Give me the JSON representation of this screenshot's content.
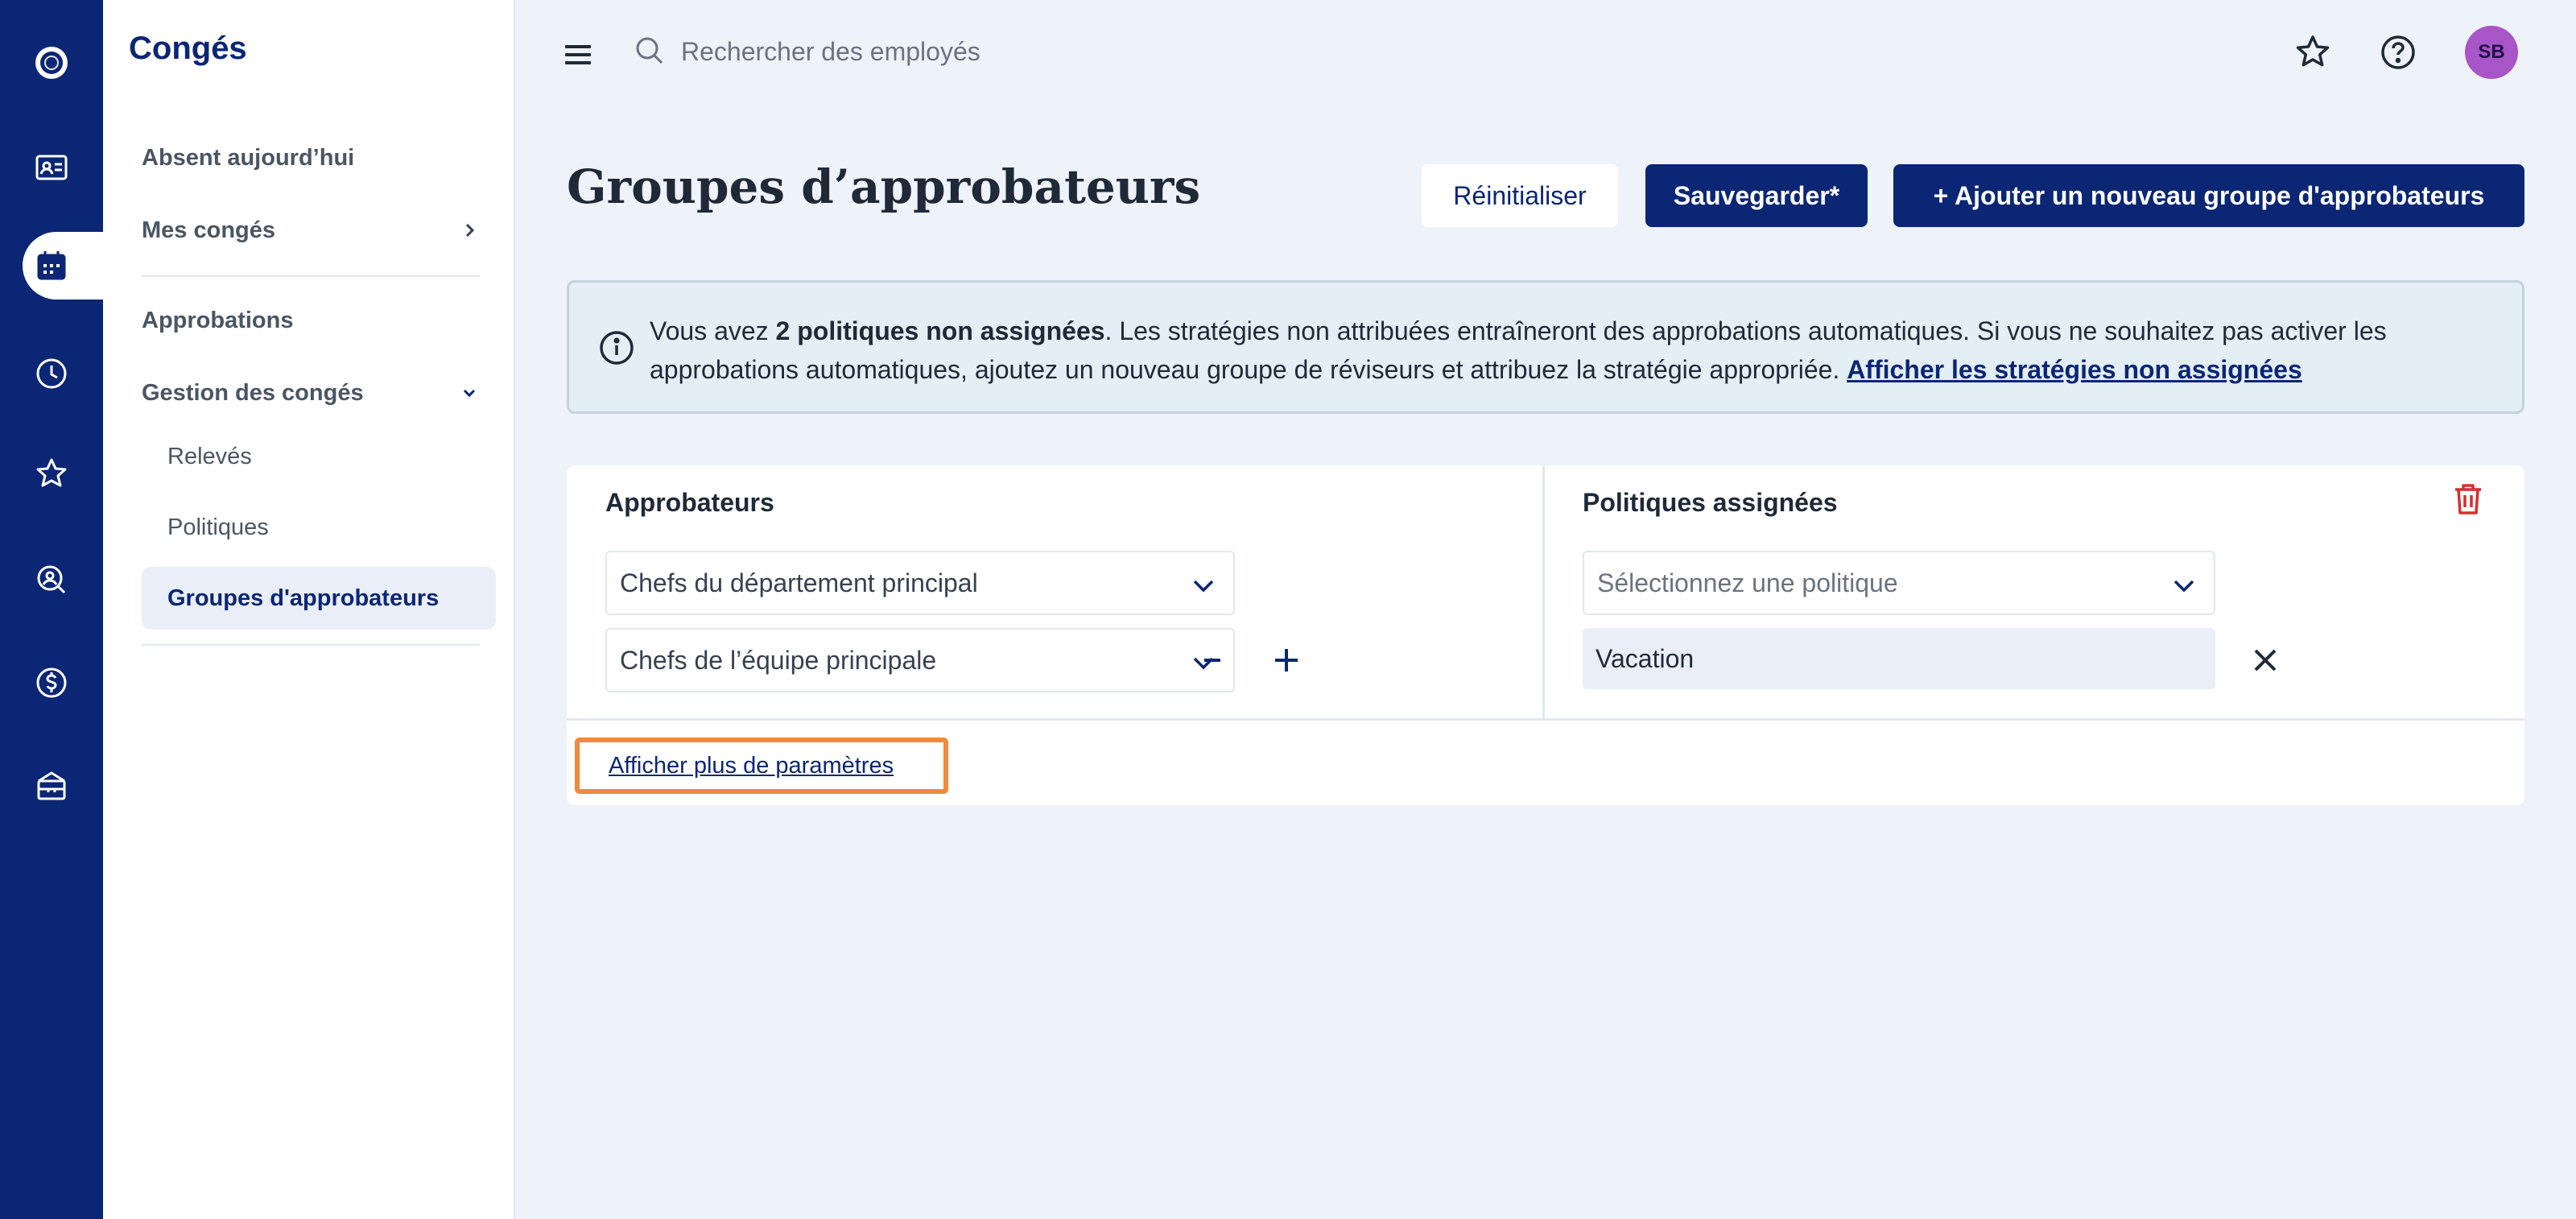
{
  "app": {
    "section_title": "Congés"
  },
  "rail": {
    "items": [
      "logo-icon",
      "contact-card-icon",
      "calendar-icon",
      "clock-icon",
      "star-icon",
      "people-search-icon",
      "dollar-icon",
      "box-icon"
    ],
    "active": "calendar-icon",
    "color": "#0b2674"
  },
  "sidebar": {
    "items": [
      {
        "label": "Absent aujourd’hui"
      },
      {
        "label": "Mes congés",
        "icon": "chevron-right-icon"
      },
      {
        "label": "Approbations"
      },
      {
        "label": "Gestion des congés",
        "icon": "chevron-down-icon"
      }
    ],
    "subitems": [
      {
        "label": "Relevés"
      },
      {
        "label": "Politiques"
      },
      {
        "label": "Groupes d'approbateurs",
        "active": true
      }
    ]
  },
  "topbar": {
    "search_placeholder": "Rechercher des employés",
    "avatar_initials": "SB",
    "avatar_color": "#a855c7"
  },
  "page": {
    "title": "Groupes d’approbateurs",
    "buttons": {
      "reset": "Réinitialiser",
      "save": "Sauvegarder*",
      "add": "+ Ajouter un nouveau groupe d'approbateurs"
    }
  },
  "alert": {
    "prefix": "Vous avez ",
    "bold": "2 politiques non assignées",
    "text": ". Les stratégies non attribuées entraîneront des approbations automatiques. Si vous ne souhaitez pas activer les approbations automatiques, ajoutez un nouveau groupe de réviseurs et attribuez la stratégie appropriée. ",
    "link": "Afficher les stratégies non assignées"
  },
  "group": {
    "approvers_header": "Approbateurs",
    "policies_header": "Politiques assignées",
    "approvers": [
      {
        "value": "Chefs du département principal"
      },
      {
        "value": "Chefs de l’équipe principale"
      }
    ],
    "policy_select_placeholder": "Sélectionnez une politique",
    "assigned_policies": [
      "Vacation"
    ],
    "more_settings_link": "Afficher plus de paramètres"
  },
  "colors": {
    "accent": "#0b2674",
    "delete": "#d32f2f",
    "highlight": "#f08a3c",
    "alert_bg": "#e3eef5"
  }
}
